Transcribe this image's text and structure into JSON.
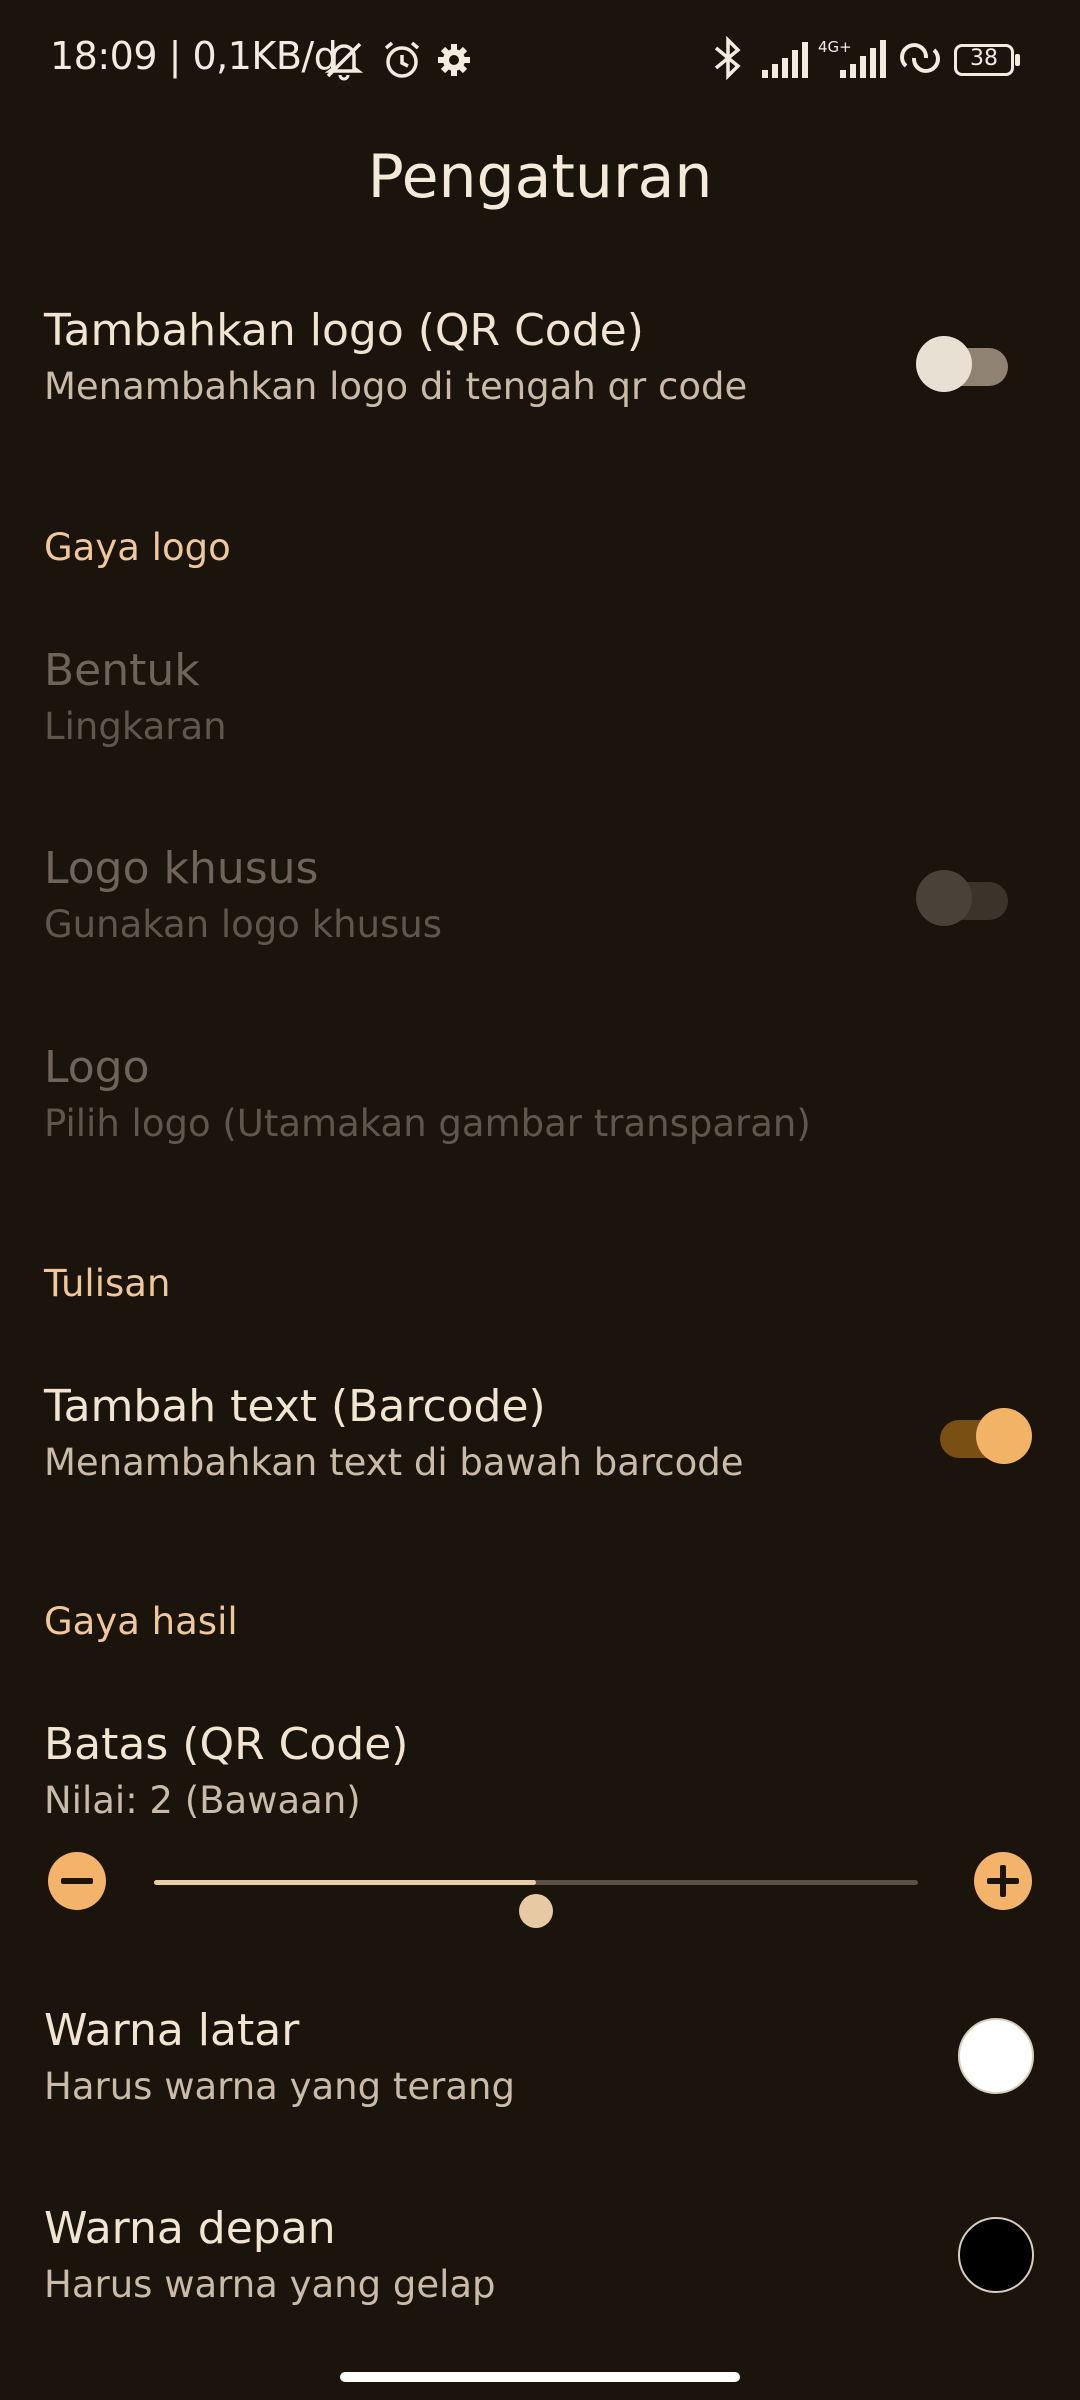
{
  "status_bar": {
    "text": "18:09 | 0,1KB/d",
    "battery": "38",
    "icons": [
      "mute-icon",
      "alarm-icon",
      "gear-icon",
      "bluetooth-icon",
      "signal-icon",
      "signal-4g-icon",
      "hotspot-icon",
      "battery-icon"
    ]
  },
  "header": {
    "title": "Pengaturan"
  },
  "settings": {
    "add_logo": {
      "title": "Tambahkan logo (QR Code)",
      "summary": "Menambahkan logo di tengah qr code",
      "checked": false
    },
    "logo_style_header": "Gaya logo",
    "shape": {
      "title": "Bentuk",
      "summary": "Lingkaran",
      "enabled": false
    },
    "custom_logo": {
      "title": "Logo khusus",
      "summary": "Gunakan logo khusus",
      "checked": false,
      "enabled": false
    },
    "logo": {
      "title": "Logo",
      "summary": "Pilih logo (Utamakan gambar transparan)",
      "enabled": false
    },
    "text_header": "Tulisan",
    "add_text": {
      "title": "Tambah text (Barcode)",
      "summary": "Menambahkan text di bawah barcode",
      "checked": true
    },
    "result_style_header": "Gaya hasil",
    "border": {
      "title": "Batas (QR Code)",
      "summary": "Nilai: 2  (Bawaan)",
      "value": 2,
      "fill_fraction": 0.5
    },
    "bg_color": {
      "title": "Warna latar",
      "summary": "Harus warna yang terang",
      "color": "#ffffff"
    },
    "fg_color": {
      "title": "Warna depan",
      "summary": "Harus warna yang gelap",
      "color": "#000000"
    }
  },
  "colors": {
    "accent": "#f2b366",
    "background": "#1b140c",
    "section": "#f0c79a"
  }
}
